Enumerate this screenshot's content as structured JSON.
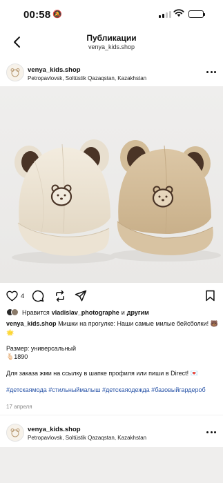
{
  "status_bar": {
    "time": "00:58",
    "bell_muted": "🔕"
  },
  "nav": {
    "title": "Публикации",
    "subtitle": "venya_kids.shop"
  },
  "post": {
    "account": "venya_kids.shop",
    "location": "Petropavlovsk, Soltüstik Qazaqstan, Kazakhstan",
    "likes_count": "4",
    "liked_by_prefix": "Нравится",
    "liked_by_user": "vladislav_photographe",
    "liked_by_and": "и",
    "liked_by_others": "другим",
    "caption_user": "venya_kids.shop",
    "caption_text": "Мишки на прогулке: Наши самые милые бейсболки! 🐻🌟",
    "size_line": "Размер: универсальный",
    "price_line": "🫰🏻1890",
    "order_line": "Для заказа жми на ссылку в шапке профиля или пиши в Direct! 💌",
    "hashtags": "#детскаямода #стильныймалыш #детскаяодежда #базовыйгардероб",
    "date": "17 апреля"
  },
  "next_post": {
    "account": "venya_kids.shop",
    "location": "Petropavlovsk, Soltüstik Qazaqstan, Kazakhstan"
  },
  "colors": {
    "hashtag": "#2a55a8",
    "cap_left": "#efe6d4",
    "cap_right": "#d9c3a1",
    "ear_inner": "#4a3426"
  }
}
